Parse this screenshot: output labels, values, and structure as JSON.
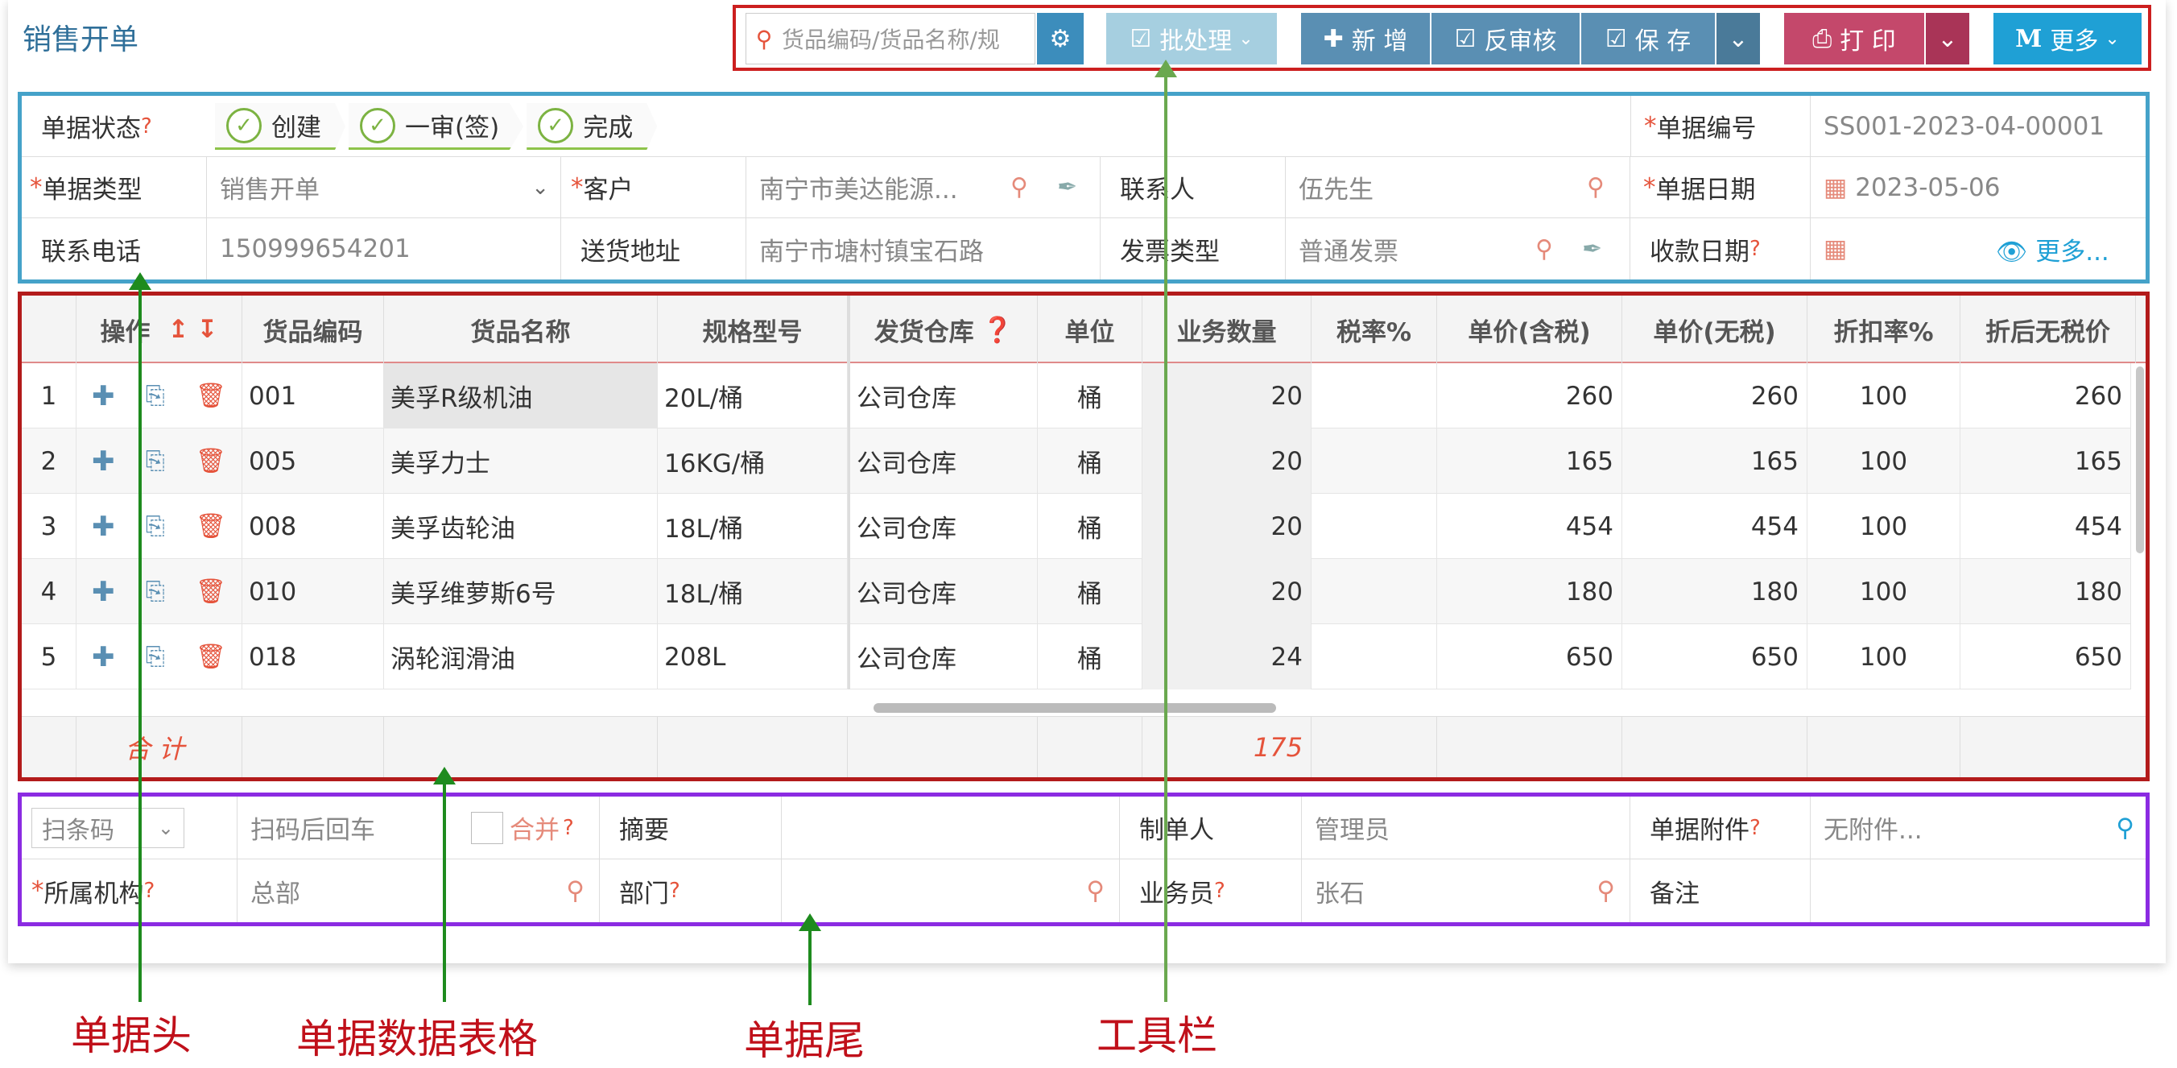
{
  "window": {
    "title": "销售开单"
  },
  "toolbar": {
    "search_placeholder": "货品编码/货品名称/规",
    "batch": "批处理",
    "new": "新 增",
    "reverse_review": "反审核",
    "save": "保 存",
    "print": "打 印",
    "more": "更多"
  },
  "header": {
    "status_label": "单据状态",
    "steps": [
      "创建",
      "一审(签)",
      "完成"
    ],
    "doc_no_label": "单据编号",
    "doc_no": "SS001-2023-04-00001",
    "doc_type_label": "单据类型",
    "doc_type": "销售开单",
    "customer_label": "客户",
    "customer": "南宁市美达能源...",
    "contact_label": "联系人",
    "contact": "伍先生",
    "doc_date_label": "单据日期",
    "doc_date": "2023-05-06",
    "phone_label": "联系电话",
    "phone": "150999654201",
    "address_label": "送货地址",
    "address": "南宁市塘村镇宝石路",
    "invoice_label": "发票类型",
    "invoice": "普通发票",
    "pay_date_label": "收款日期",
    "more_link": "更多..."
  },
  "grid": {
    "columns": [
      "操作",
      "货品编码",
      "货品名称",
      "规格型号",
      "发货仓库",
      "单位",
      "业务数量",
      "税率%",
      "单价(含税)",
      "单价(无税)",
      "折扣率%",
      "折后无税价"
    ],
    "rows": [
      {
        "no": "1",
        "code": "001",
        "name": "美孚R级机油",
        "spec": "20L/桶",
        "wh": "公司仓库",
        "unit": "桶",
        "qty": "20",
        "tax": "",
        "p_tax": "260",
        "p_net": "260",
        "disc": "100",
        "after": "260"
      },
      {
        "no": "2",
        "code": "005",
        "name": "美孚力士",
        "spec": "16KG/桶",
        "wh": "公司仓库",
        "unit": "桶",
        "qty": "20",
        "tax": "",
        "p_tax": "165",
        "p_net": "165",
        "disc": "100",
        "after": "165"
      },
      {
        "no": "3",
        "code": "008",
        "name": "美孚齿轮油",
        "spec": "18L/桶",
        "wh": "公司仓库",
        "unit": "桶",
        "qty": "20",
        "tax": "",
        "p_tax": "454",
        "p_net": "454",
        "disc": "100",
        "after": "454"
      },
      {
        "no": "4",
        "code": "010",
        "name": "美孚维萝斯6号",
        "spec": "18L/桶",
        "wh": "公司仓库",
        "unit": "桶",
        "qty": "20",
        "tax": "",
        "p_tax": "180",
        "p_net": "180",
        "disc": "100",
        "after": "180"
      },
      {
        "no": "5",
        "code": "018",
        "name": "涡轮润滑油",
        "spec": "208L",
        "wh": "公司仓库",
        "unit": "桶",
        "qty": "24",
        "tax": "",
        "p_tax": "650",
        "p_net": "650",
        "disc": "100",
        "after": "650"
      }
    ],
    "total_label": "合 计",
    "total_qty": "175"
  },
  "footer": {
    "scan_select": "扫条码",
    "scan_placeholder": "扫码后回车",
    "merge_label": "合并",
    "summary_label": "摘要",
    "maker_label": "制单人",
    "maker": "管理员",
    "attach_label": "单据附件",
    "attach": "无附件...",
    "org_label": "所属机构",
    "org": "总部",
    "dept_label": "部门",
    "salesman_label": "业务员",
    "salesman": "张石",
    "remark_label": "备注"
  },
  "annotations": {
    "header": "单据头",
    "grid": "单据数据表格",
    "footer": "单据尾",
    "toolbar": "工具栏"
  },
  "colors": {
    "toolbar_box": "#cc1f1f",
    "header_box": "#45a2c9",
    "grid_box": "#b31b1b",
    "footer_box": "#8b2be2",
    "arrow": "#1e8b1e",
    "caption": "#c0101a"
  }
}
